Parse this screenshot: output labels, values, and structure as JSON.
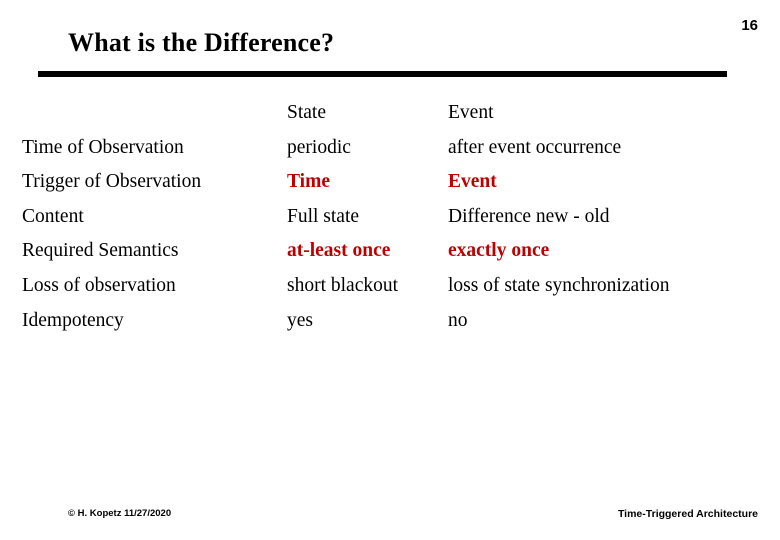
{
  "slide": {
    "number": "16",
    "title": "What is the Difference?",
    "footer_left": "© H. Kopetz  11/27/2020",
    "footer_right": "Time-Triggered Architecture",
    "accent_color": "#c00000",
    "rule_color": "#000000"
  },
  "table": {
    "headers": [
      "",
      "State",
      "Event"
    ],
    "rows": [
      {
        "label": "Time of Observation",
        "state": "periodic",
        "event": "after event occurrence",
        "state_highlight": false,
        "event_highlight": false
      },
      {
        "label": "Trigger of Observation",
        "state": "Time",
        "event": "Event",
        "state_highlight": true,
        "event_highlight": true
      },
      {
        "label": "Content",
        "state": "Full state",
        "event": "Difference new - old",
        "state_highlight": false,
        "event_highlight": false
      },
      {
        "label": "Required Semantics",
        "state": "at-least once",
        "event": "exactly once",
        "state_highlight": true,
        "event_highlight": true
      },
      {
        "label": "Loss of observation",
        "state": "short blackout",
        "event": "loss of state synchronization",
        "state_highlight": false,
        "event_highlight": false
      },
      {
        "label": "Idempotency",
        "state": "yes",
        "event": "no",
        "state_highlight": false,
        "event_highlight": false
      }
    ]
  }
}
